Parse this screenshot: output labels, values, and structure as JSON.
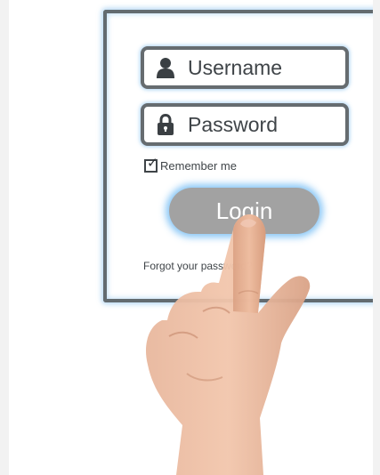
{
  "login_form": {
    "username_placeholder": "Username",
    "password_placeholder": "Password",
    "remember_label": "Remember me",
    "remember_checked": true,
    "login_label": "Login",
    "forgot_link": "Forgot your password?"
  },
  "icons": {
    "username": "user-icon",
    "password": "lock-icon",
    "checkbox": "check-icon"
  },
  "colors": {
    "panel_border": "#636b70",
    "field_border": "#666c70",
    "glow": "#78bef5",
    "button_fill": "#a2a2a2",
    "text": "#3f4448"
  }
}
